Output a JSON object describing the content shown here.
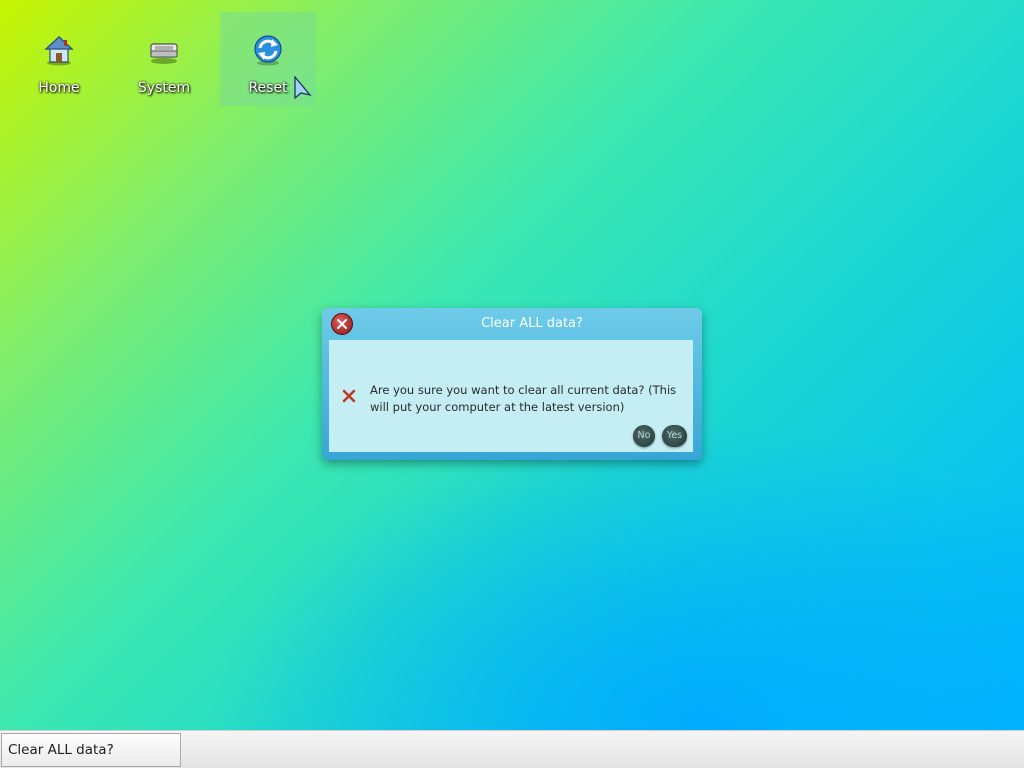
{
  "desktop": {
    "icons": [
      {
        "label": "Home",
        "icon": "home-icon"
      },
      {
        "label": "System",
        "icon": "drive-icon"
      },
      {
        "label": "Reset",
        "icon": "refresh-icon",
        "selected": true
      }
    ]
  },
  "dialog": {
    "title": "Clear ALL data?",
    "message": "Are you sure you want to clear all current data? (This will put your computer at the latest version)",
    "icon": "error-x-icon",
    "close_icon": "close-icon",
    "buttons": {
      "no": "No",
      "yes": "Yes"
    }
  },
  "taskbar": {
    "items": [
      {
        "label": "Clear ALL data?"
      }
    ]
  },
  "colors": {
    "dialog_title_bg": "#4fb7e0",
    "dialog_body_bg": "#c4eef3",
    "close_button": "#b32a2a",
    "taskbar_bg": "#ececec"
  }
}
